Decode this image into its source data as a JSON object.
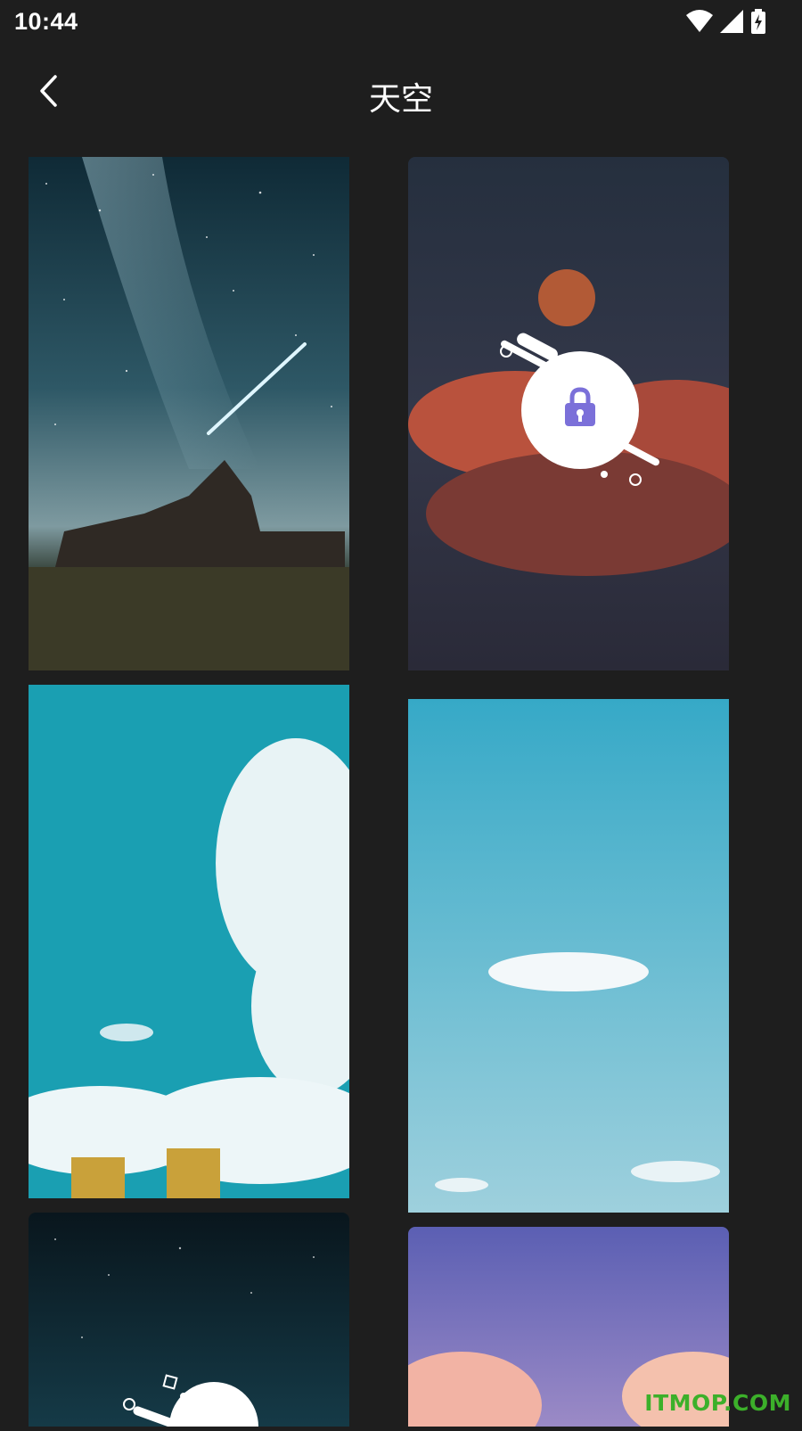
{
  "status_bar": {
    "time": "10:44",
    "icons": [
      "wifi-icon",
      "signal-icon",
      "battery-charging-icon"
    ]
  },
  "header": {
    "back_icon": "chevron-left-icon",
    "title": "天空"
  },
  "wallpapers": [
    {
      "id": 1,
      "description": "starry sky with church and meteor",
      "locked": false
    },
    {
      "id": 2,
      "description": "moon over red clouds",
      "locked": true
    },
    {
      "id": 3,
      "description": "blue sky with white clouds and buildings",
      "locked": false
    },
    {
      "id": 4,
      "description": "light blue sky with a small cloud",
      "locked": false
    },
    {
      "id": 5,
      "description": "dark starry sky",
      "locked": true
    },
    {
      "id": 6,
      "description": "purple sky with pink clouds",
      "locked": false
    }
  ],
  "watermark": "ITMOP.COM",
  "colors": {
    "background": "#1e1e1e",
    "lock_accent": "#7b70d9",
    "watermark": "#3cb02a"
  }
}
